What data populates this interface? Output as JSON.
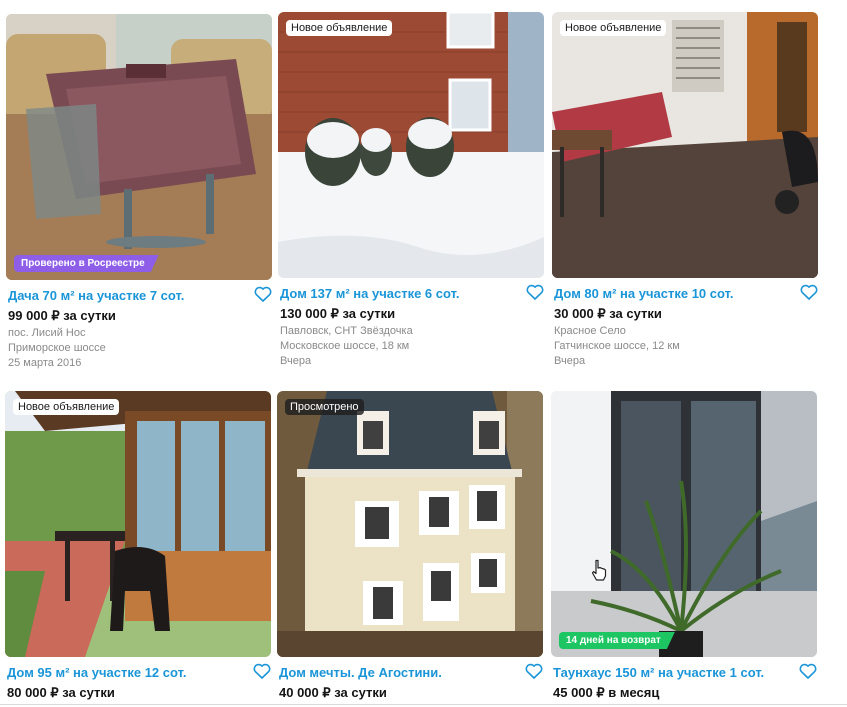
{
  "listings": [
    {
      "badge_top": "",
      "badge_bottom": "Проверено в Росреестре",
      "title": "Дача 70 м² на участке 7 сот.",
      "price": "99 000 ₽ за сутки",
      "line1": "пос. Лисий Нос",
      "line2": "Приморское шоссе",
      "line3": "25 марта 2016"
    },
    {
      "badge_top": "Новое объявление",
      "badge_bottom": "",
      "title": "Дом 137 м² на участке 6 сот.",
      "price": "130 000 ₽ за сутки",
      "line1": "Павловск, СНТ Звёздочка",
      "line2": "Московское шоссе, 18 км",
      "line3": "Вчера"
    },
    {
      "badge_top": "Новое объявление",
      "badge_bottom": "",
      "title": "Дом 80 м² на участке 10 сот.",
      "price": "30 000 ₽ за сутки",
      "line1": "Красное Село",
      "line2": "Гатчинское шоссе, 12 км",
      "line3": "Вчера"
    },
    {
      "badge_top": "Новое объявление",
      "badge_bottom": "",
      "title": "Дом 95 м² на участке 12 сот.",
      "price": "80 000 ₽ за сутки",
      "line1": "",
      "line2": "",
      "line3": ""
    },
    {
      "badge_top": "Просмотрено",
      "badge_bottom": "",
      "title": "Дом мечты. Де Агостини.",
      "price": "40 000 ₽ за сутки",
      "line1": "",
      "line2": "",
      "line3": ""
    },
    {
      "badge_top": "",
      "badge_bottom": "14 дней на возврат",
      "title": "Таунхаус 150 м² на участке 1 сот.",
      "price": "45 000 ₽ в месяц",
      "line1": "",
      "line2": "",
      "line3": ""
    }
  ],
  "colors": {
    "link": "#1995d8",
    "price": "#141414",
    "muted": "#8a8a8a",
    "badge_purple": "#8e5ee8",
    "badge_green": "#1ec663"
  },
  "icons": {
    "favorite": "heart-outline-icon",
    "cursor": "hand-pointer-icon"
  }
}
